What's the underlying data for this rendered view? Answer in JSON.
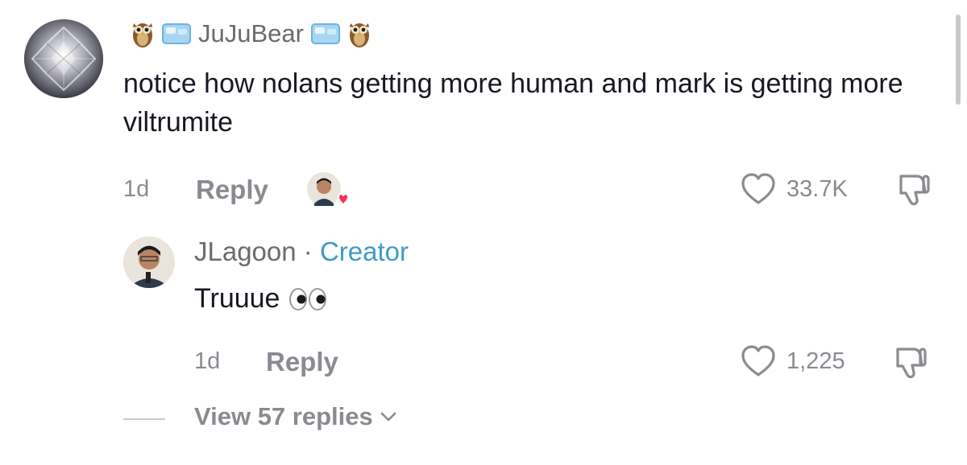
{
  "comment": {
    "username": "JuJuBear",
    "text": "notice how nolans getting more human and mark is getting more viltrumite",
    "time": "1d",
    "reply_label": "Reply",
    "likes": "33.7K"
  },
  "reply": {
    "username": "JLagoon",
    "separator": " · ",
    "badge": "Creator",
    "text": "Truuue",
    "time": "1d",
    "reply_label": "Reply",
    "likes": "1,225"
  },
  "view_replies": {
    "label": "View 57 replies"
  },
  "icons": {
    "owl": "owl-emoji-icon",
    "ice": "ice-cube-emoji-icon",
    "eyes": "eyes-emoji-icon",
    "heart": "heart-outline-icon",
    "dislike": "thumbs-down-icon",
    "chevron": "chevron-down-icon",
    "liked_by_creator": "creator-heart-badge-icon"
  },
  "colors": {
    "text": "#161823",
    "secondary": "#8a8b91",
    "creator_accent": "#3f9ac6",
    "heart_red": "#fe2c55"
  }
}
